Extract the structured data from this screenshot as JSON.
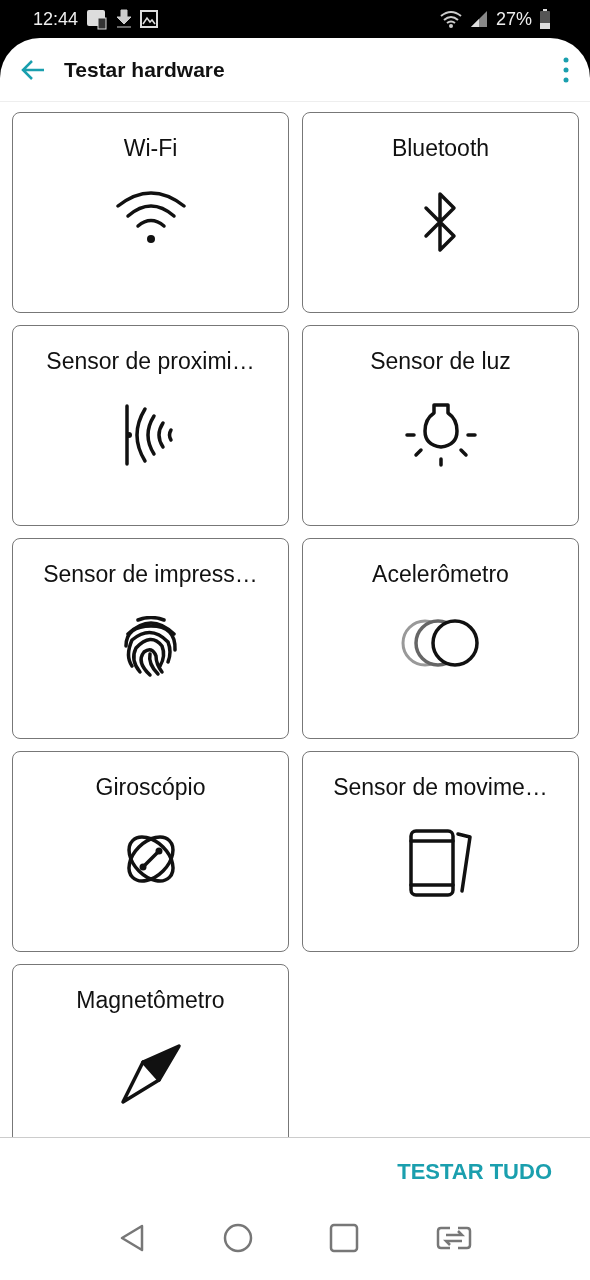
{
  "status_bar": {
    "time": "12:44",
    "battery": "27%"
  },
  "header": {
    "title": "Testar hardware"
  },
  "tiles": [
    {
      "label": "Wi-Fi",
      "kind": "wifi"
    },
    {
      "label": "Bluetooth",
      "kind": "bluetooth"
    },
    {
      "label": "Sensor de proximi…",
      "kind": "proximity"
    },
    {
      "label": "Sensor de luz",
      "kind": "light"
    },
    {
      "label": "Sensor de impress…",
      "kind": "fingerprint"
    },
    {
      "label": "Acelerômetro",
      "kind": "accelerometer"
    },
    {
      "label": "Giroscópio",
      "kind": "gyroscope"
    },
    {
      "label": "Sensor de movime…",
      "kind": "motion"
    },
    {
      "label": "Magnetômetro",
      "kind": "compass"
    }
  ],
  "footer": {
    "action": "TESTAR TUDO"
  }
}
